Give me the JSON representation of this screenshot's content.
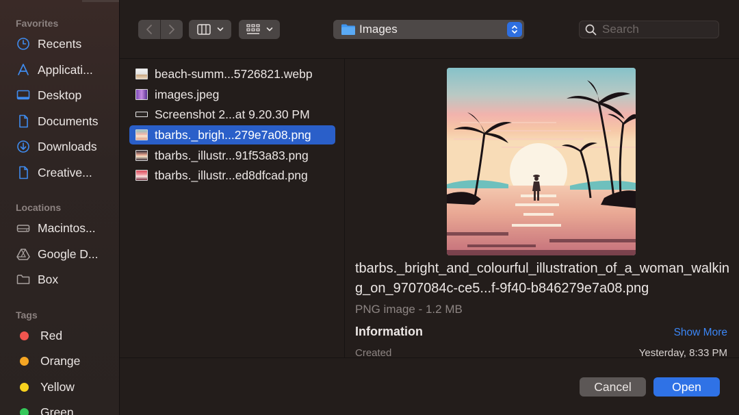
{
  "sidebar": {
    "favorites_header": "Favorites",
    "favorites": [
      {
        "label": "Recents",
        "icon": "clock-icon"
      },
      {
        "label": "Applicati...",
        "icon": "applications-icon"
      },
      {
        "label": "Desktop",
        "icon": "desktop-icon"
      },
      {
        "label": "Documents",
        "icon": "document-icon"
      },
      {
        "label": "Downloads",
        "icon": "download-icon"
      },
      {
        "label": "Creative...",
        "icon": "document-icon"
      }
    ],
    "locations_header": "Locations",
    "locations": [
      {
        "label": "Macintos...",
        "icon": "drive-icon"
      },
      {
        "label": "Google D...",
        "icon": "google-drive-icon"
      },
      {
        "label": "Box",
        "icon": "folder-icon"
      }
    ],
    "tags_header": "Tags",
    "tags": [
      {
        "label": "Red",
        "color": "#f0554f"
      },
      {
        "label": "Orange",
        "color": "#f5a623"
      },
      {
        "label": "Yellow",
        "color": "#f7d21e"
      },
      {
        "label": "Green",
        "color": "#34c759"
      }
    ]
  },
  "toolbar": {
    "path_label": "Images",
    "search_placeholder": "Search"
  },
  "files": [
    {
      "name": "beach-summ...5726821.webp",
      "selected": false
    },
    {
      "name": "images.jpeg",
      "selected": false
    },
    {
      "name": "Screenshot 2...at 9.20.30 PM",
      "selected": false
    },
    {
      "name": "tbarbs._brigh...279e7a08.png",
      "selected": true
    },
    {
      "name": "tbarbs._illustr...91f53a83.png",
      "selected": false
    },
    {
      "name": "tbarbs._illustr...ed8dfcad.png",
      "selected": false
    }
  ],
  "preview": {
    "filename": "tbarbs._bright_and_colourful_illustration_of_a_woman_walking_on_9707084c-ce5...f-9f40-b846279e7a08.png",
    "kind": "PNG image - 1.2 MB",
    "info_header": "Information",
    "show_more": "Show More",
    "created_label": "Created",
    "created_value": "Yesterday, 8:33 PM"
  },
  "buttons": {
    "cancel": "Cancel",
    "open": "Open"
  },
  "colors": {
    "accent": "#2f72e6",
    "selection": "#2a5fc9"
  }
}
